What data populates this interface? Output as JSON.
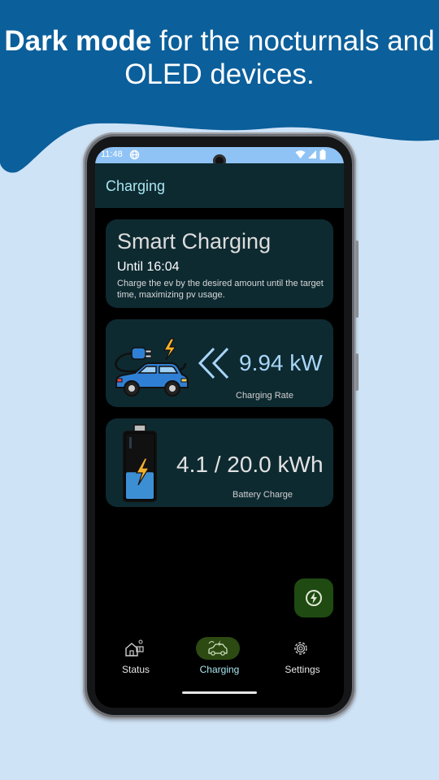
{
  "banner": {
    "title_bold": "Dark mode",
    "title_rest": " for the nocturnals and OLED devices."
  },
  "statusbar": {
    "time": "11:48",
    "icons": [
      "network-globe-icon",
      "wifi-icon",
      "signal-icon",
      "battery-icon"
    ]
  },
  "appbar": {
    "title": "Charging"
  },
  "smart_charging": {
    "title": "Smart Charging",
    "until": "Until 16:04",
    "description": "Charge the ev by the desired amount until the target time, maximizing pv usage."
  },
  "charging_rate": {
    "value": "9.94 kW",
    "label": "Charging Rate",
    "icon": "ev-charging-car-icon"
  },
  "battery": {
    "value": "4.1 / 20.0 kWh",
    "label": "Battery Charge",
    "icon": "battery-charging-icon",
    "level": 0.205
  },
  "fab": {
    "icon": "bolt-circle-icon"
  },
  "nav": [
    {
      "label": "Status",
      "icon": "house-solar-icon",
      "active": false
    },
    {
      "label": "Charging",
      "icon": "ev-car-icon",
      "active": true
    },
    {
      "label": "Settings",
      "icon": "gear-icon",
      "active": false
    }
  ],
  "colors": {
    "banner": "#0b5f9b",
    "page_bg": "#cfe3f7",
    "card_bg": "#0e2a31",
    "accent_text": "#a9e6f0",
    "fab_bg": "#1f4a12"
  }
}
